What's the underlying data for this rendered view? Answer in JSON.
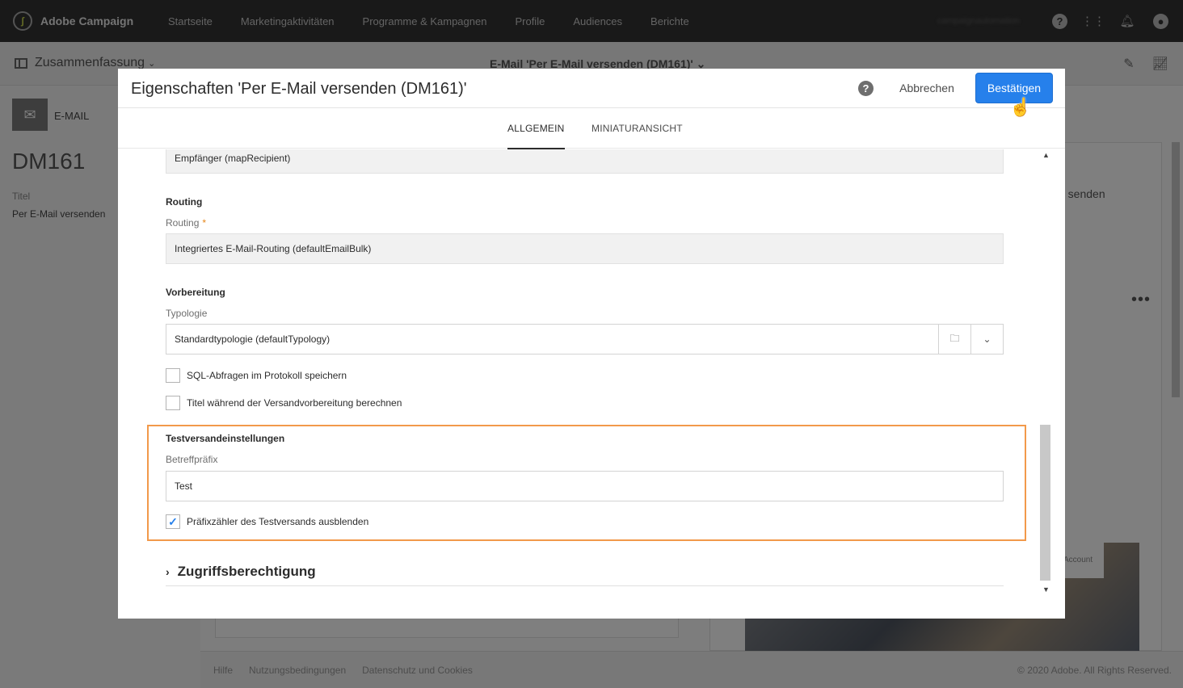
{
  "topbar": {
    "app_name": "Adobe Campaign",
    "nav": [
      "Startseite",
      "Marketingaktivitäten",
      "Programme & Kampagnen",
      "Profile",
      "Audiences",
      "Berichte"
    ],
    "user": "campaignautomation"
  },
  "subbar": {
    "left_title": "Zusammenfassung",
    "center_title": "E-Mail 'Per E-Mail versenden (DM161)'"
  },
  "left_panel": {
    "type_label": "E-MAIL",
    "code": "DM161",
    "title_label": "Titel",
    "title_value": "Per E-Mail versenden"
  },
  "background": {
    "senden_fragment": "u senden",
    "image_label": "Account"
  },
  "footer": {
    "links": [
      "Hilfe",
      "Nutzungsbedingungen",
      "Datenschutz und Cookies"
    ],
    "copyright": "© 2020 Adobe. All Rights Reserved."
  },
  "modal": {
    "title": "Eigenschaften 'Per E-Mail versenden (DM161)'",
    "help": "?",
    "cancel_label": "Abbrechen",
    "confirm_label": "Bestätigen",
    "tabs": [
      {
        "label": "ALLGEMEIN",
        "active": true
      },
      {
        "label": "MINIATURANSICHT",
        "active": false
      }
    ],
    "recipient_value": "Empfänger (mapRecipient)",
    "routing": {
      "section": "Routing",
      "label": "Routing",
      "required_mark": "*",
      "value": "Integriertes E-Mail-Routing (defaultEmailBulk)"
    },
    "preparation": {
      "section": "Vorbereitung",
      "typology_label": "Typologie",
      "typology_value": "Standardtypologie (defaultTypology)",
      "checkbox_sql": "SQL-Abfragen im Protokoll speichern",
      "checkbox_sql_checked": false,
      "checkbox_title": "Titel während der Versandvorbereitung berechnen",
      "checkbox_title_checked": false
    },
    "test": {
      "section": "Testversandeinstellungen",
      "prefix_label": "Betreffpräfix",
      "prefix_value": "Test",
      "checkbox_hide": "Präfixzähler des Testversands ausblenden",
      "checkbox_hide_checked": true
    },
    "access": {
      "label": "Zugriffsberechtigung"
    }
  },
  "colors": {
    "accent": "#2680eb",
    "highlight": "#f2994a",
    "topbar": "#323232"
  }
}
